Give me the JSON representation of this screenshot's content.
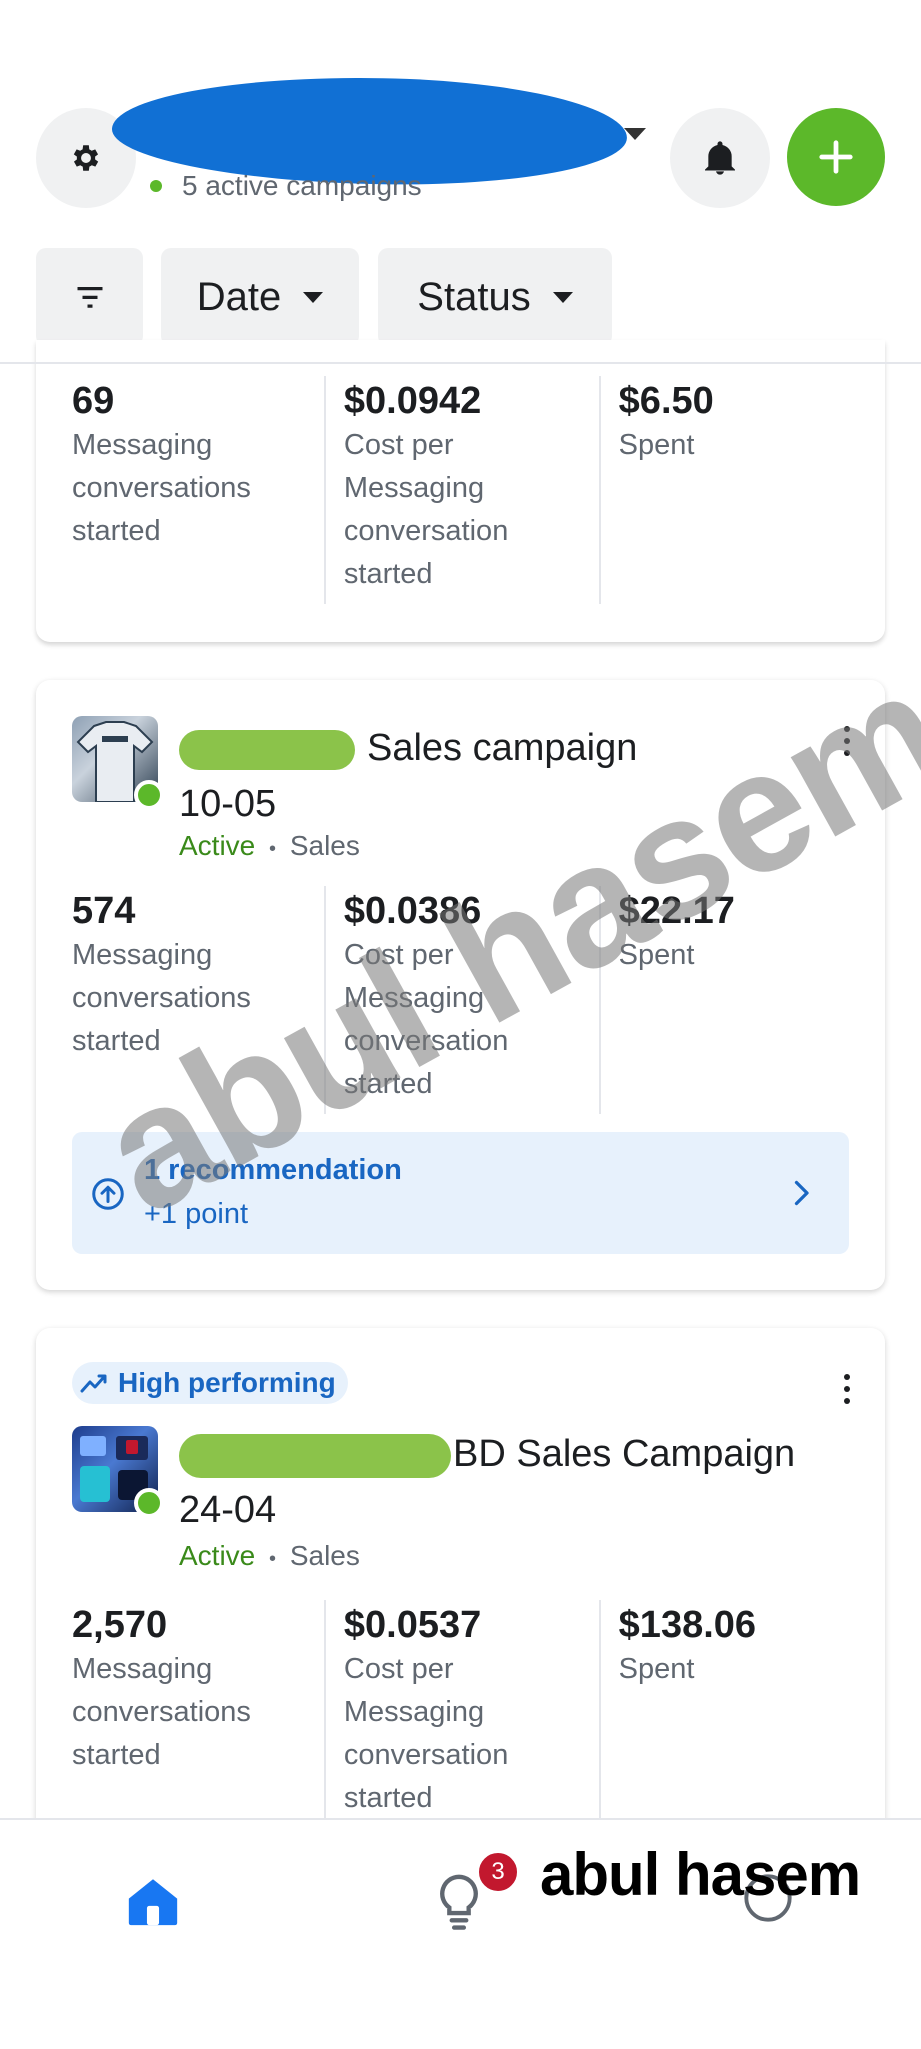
{
  "header": {
    "status_text": "5 active campaigns",
    "brand_green": "#5cb82a",
    "redaction_color": "#1170d4"
  },
  "filters": {
    "date_label": "Date",
    "status_label": "Status"
  },
  "campaigns": [
    {
      "metrics": [
        {
          "value": "69",
          "label": "Messaging conversations started"
        },
        {
          "value": "$0.0942",
          "label": "Cost per Messaging conversation started"
        },
        {
          "value": "$6.50",
          "label": "Spent"
        }
      ]
    },
    {
      "title_rest": "Sales campaign",
      "title_line2": "10-05",
      "status": "Active",
      "sep": "•",
      "objective": "Sales",
      "metrics": [
        {
          "value": "574",
          "label": "Messaging conversations started"
        },
        {
          "value": "$0.0386",
          "label": "Cost per Messaging conversation started"
        },
        {
          "value": "$22.17",
          "label": "Spent"
        }
      ],
      "recommendation": {
        "title": "1 recommendation",
        "points": "+1 point"
      }
    },
    {
      "badge": "High performing",
      "title_rest": "BD Sales Campaign",
      "title_line2": "24-04",
      "status": "Active",
      "sep": "•",
      "objective": "Sales",
      "metrics": [
        {
          "value": "2,570",
          "label": "Messaging conversations started"
        },
        {
          "value": "$0.0537",
          "label": "Cost per Messaging conversation started"
        },
        {
          "value": "$138.06",
          "label": "Spent"
        }
      ]
    }
  ],
  "nav": {
    "ideas_badge": "3"
  },
  "watermark": {
    "diagonal": "abul hasem",
    "corner": "abul hasem"
  }
}
